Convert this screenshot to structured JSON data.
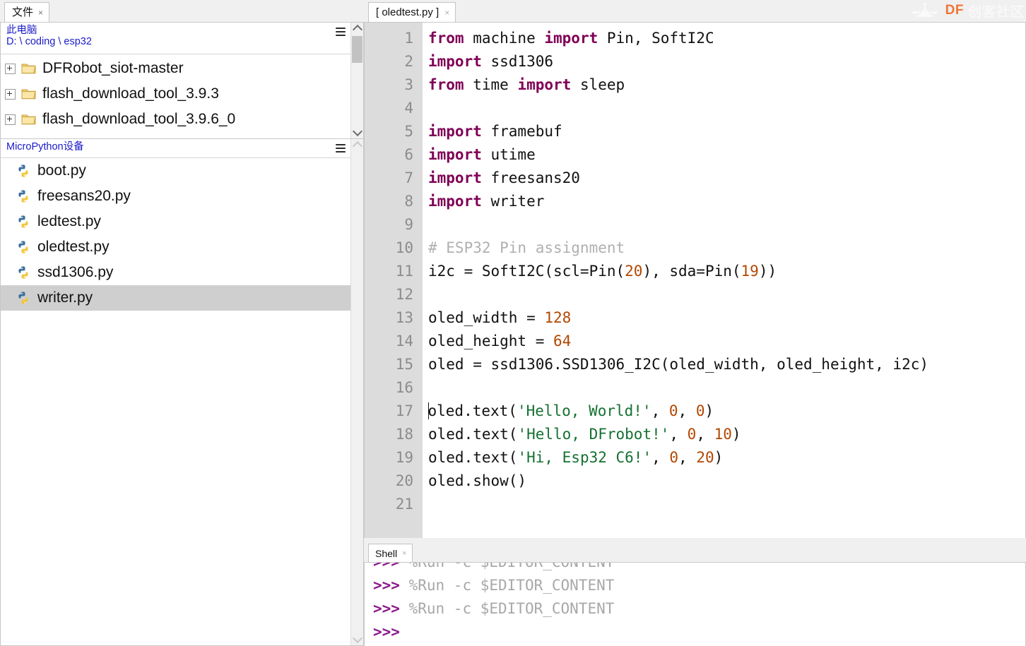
{
  "files_panel": {
    "tab": {
      "label": "文件",
      "close": "×"
    },
    "computer": {
      "title": "此电脑",
      "path": "D: \\ coding \\ esp32",
      "menu_icon": "hamburger-icon"
    },
    "tree_items": [
      {
        "label": "DFRobot_siot-master",
        "icon": "folder-icon",
        "expander": "plus-box"
      },
      {
        "label": "flash_download_tool_3.9.3",
        "icon": "folder-icon",
        "expander": "plus-box"
      },
      {
        "label": "flash_download_tool_3.9.6_0",
        "icon": "folder-icon",
        "expander": "plus-box"
      }
    ],
    "scrollbar": {
      "up_arrow": "chevron-up-icon",
      "down_arrow": "chevron-down-icon"
    }
  },
  "device_panel": {
    "title": "MicroPython设备",
    "menu_icon": "hamburger-icon",
    "files": [
      {
        "label": "boot.py",
        "icon": "python-file-icon",
        "selected": false
      },
      {
        "label": "freesans20.py",
        "icon": "python-file-icon",
        "selected": false
      },
      {
        "label": "ledtest.py",
        "icon": "python-file-icon",
        "selected": false
      },
      {
        "label": "oledtest.py",
        "icon": "python-file-icon",
        "selected": false
      },
      {
        "label": "ssd1306.py",
        "icon": "python-file-icon",
        "selected": false
      },
      {
        "label": "writer.py",
        "icon": "python-file-icon",
        "selected": true
      }
    ],
    "scrollbar": {
      "up_arrow": "chevron-up-icon",
      "down_arrow": "chevron-down-icon"
    }
  },
  "editor": {
    "tab": {
      "label": "[ oledtest.py ]",
      "close": "×"
    },
    "line_numbers": [
      "1",
      "2",
      "3",
      "4",
      "5",
      "6",
      "7",
      "8",
      "9",
      "10",
      "11",
      "12",
      "13",
      "14",
      "15",
      "16",
      "17",
      "18",
      "19",
      "20",
      "21"
    ],
    "lines": [
      "from machine import Pin, SoftI2C",
      "import ssd1306",
      "from time import sleep",
      "",
      "import framebuf",
      "import utime",
      "import freesans20",
      "import writer",
      "",
      "# ESP32 Pin assignment",
      "i2c = SoftI2C(scl=Pin(20), sda=Pin(19))",
      "",
      "oled_width = 128",
      "oled_height = 64",
      "oled = ssd1306.SSD1306_I2C(oled_width, oled_height, i2c)",
      "",
      "oled.text('Hello, World!', 0, 0)",
      "oled.text('Hello, DFrobot!', 0, 10)",
      "oled.text('Hi, Esp32 C6!', 0, 20)",
      "oled.show()",
      ""
    ],
    "caret_line": 17
  },
  "shell": {
    "tab": {
      "label": "Shell",
      "close": "×"
    },
    "lines": [
      {
        "prompt": ">>>",
        "text": " %Run -c $EDITOR_CONTENT"
      },
      {
        "prompt": ">>>",
        "text": " %Run -c $EDITOR_CONTENT"
      },
      {
        "prompt": ">>>",
        "text": " %Run -c $EDITOR_CONTENT"
      },
      {
        "prompt": ">>>",
        "text": ""
      }
    ]
  },
  "watermark": {
    "brand": "DF",
    "brand_cn": "创客社区",
    "icon": "drone-icon"
  },
  "colors": {
    "keyword": "#7f0055",
    "string": "#157031",
    "number": "#b34700",
    "comment": "#b0b0b0",
    "prompt": "#8b1a8b",
    "tree_header": "#1b1bc8",
    "selection": "#cfcfcf",
    "gutter": "#dcdcdc",
    "brand_orange": "#f07030"
  }
}
